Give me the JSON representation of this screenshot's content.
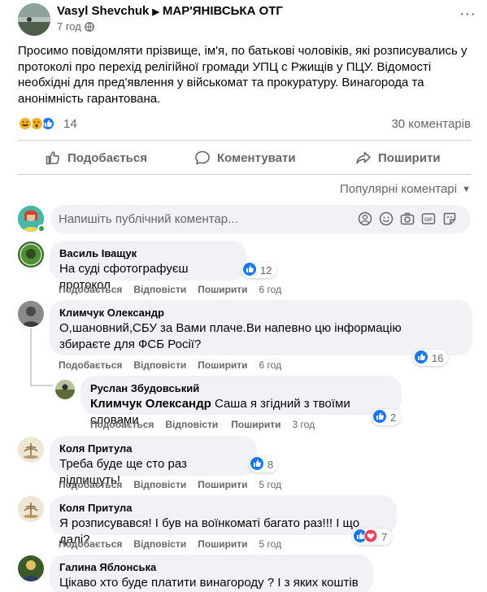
{
  "post": {
    "author": "Vasyl Shevchuk",
    "group": "МАР'ЯНІВСЬКА ОТГ",
    "time": "7 год",
    "more": "···",
    "text": "Просимо повідомляти прізвище, ім'я, по батькові чоловіків, які розписувались у протоколі про перехід релігійної громади УПЦ с Ржищів у ПЦУ. Відомості необхідні для пред'явлення у військомат та прокуратуру. Винагорода та анонімність гарантована.",
    "reactions_count": "14",
    "comments_count": "30 коментарів"
  },
  "actions": {
    "like": "Подобається",
    "comment": "Коментувати",
    "share": "Поширити"
  },
  "sort_label": "Популярні коментарі",
  "composer": {
    "placeholder": "Напишіть публічний коментар..."
  },
  "colors": {
    "like_blue": "#1877f2",
    "love_red": "#f33e58",
    "haha_yellow": "#f7b125",
    "secondary_text": "#65676b",
    "bubble_bg": "#f0f2f5"
  },
  "comments": [
    {
      "author": "Василь Іващук",
      "text": "На суді сфотографуєш протокол",
      "reactions": "12",
      "like": "Подобається",
      "reply": "Відповісти",
      "share": "Поширити",
      "time": "6 год"
    },
    {
      "author": "Климчук Олександр",
      "text": "О,шановний,СБУ за Вами плаче.Ви напевно цю інформацію збираєте для ФСБ Росії?",
      "text_line1": "О,шановний,СБУ за Вами плаче.Ви напевно цю інформацію",
      "text_line2": "збираєте для ФСБ Росії?",
      "reactions": "16",
      "like": "Подобається",
      "reply": "Відповісти",
      "share": "Поширити",
      "time": "6 год",
      "reply_comment": {
        "author": "Руслан Збудовський",
        "mention": "Климчук Олександр",
        "text": "Саша я згідний з твоїми словами",
        "reactions": "2",
        "like": "Подобається",
        "reply": "Відповісти",
        "share": "Поширити",
        "time": "3 год"
      }
    },
    {
      "author": "Коля Притула",
      "text": "Треба буде ще сто раз підпишуть!",
      "reactions": "8",
      "like": "Подобається",
      "reply": "Відповісти",
      "share": "Поширити",
      "time": "5 год"
    },
    {
      "author": "Коля Притула",
      "text": "Я розписувався! І був на воїнкоматі багато раз!!! І що далі?",
      "reactions": "7",
      "like": "Подобається",
      "reply": "Відповісти",
      "share": "Поширити",
      "time": "5 год"
    },
    {
      "author": "Галина Яблонська",
      "text": "Цікаво хто буде платити винагороду ? І з яких коштів ?"
    }
  ]
}
